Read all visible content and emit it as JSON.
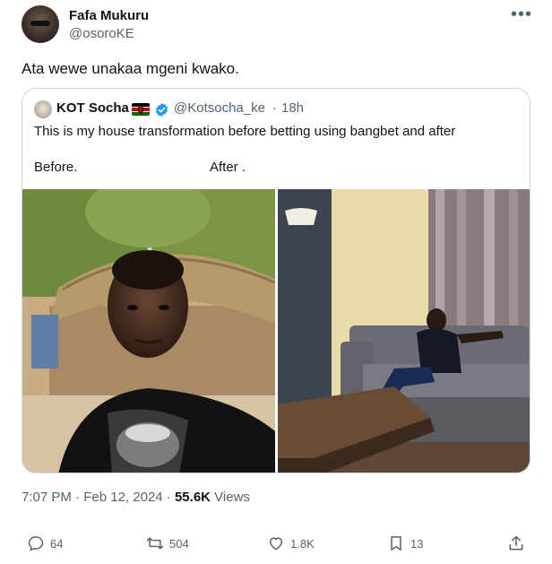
{
  "author": {
    "name": "Fafa Mukuru",
    "handle": "@osoroKE"
  },
  "more_icon": "•••",
  "text": "Ata wewe unakaa mgeni kwako.",
  "quoted": {
    "name": "KOT Socha",
    "handle": "@Kotsocha_ke",
    "dot": "·",
    "time": "18h",
    "line1": "This is my house transformation before betting using bangbet and after",
    "before_label": "Before.",
    "after_label": "After ."
  },
  "meta": {
    "time": "7:07 PM",
    "sep": "·",
    "date": "Feb 12, 2024",
    "sep2": "·",
    "views": "55.6K",
    "views_label": "Views"
  },
  "actions": {
    "replies": "64",
    "reposts": "504",
    "likes": "1.8K",
    "bookmarks": "13"
  },
  "colors": {
    "verified": "#1d9bf0",
    "muted": "#536471",
    "text": "#0f1419",
    "border": "#cfd9de"
  },
  "icons": [
    "reply-icon",
    "repost-icon",
    "like-icon",
    "bookmark-icon",
    "share-icon",
    "verified-badge-icon",
    "kenya-flag-icon"
  ]
}
